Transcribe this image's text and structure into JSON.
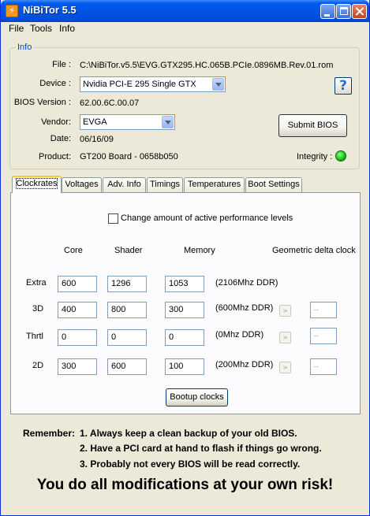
{
  "window": {
    "title": "NiBiTor 5.5"
  },
  "menu": {
    "items": [
      "File",
      "Tools",
      "Info"
    ]
  },
  "info": {
    "group_label": "Info",
    "file_label": "File :",
    "file_value": "C:\\NiBiTor.v5.5\\EVG.GTX295.HC.065B.PCIe.0896MB.Rev.01.rom",
    "device_label": "Device :",
    "device_value": "Nvidia PCI-E 295 Single GTX",
    "bios_label": "BIOS Version :",
    "bios_value": "62.00.6C.00.07",
    "vendor_label": "Vendor:",
    "vendor_value": "EVGA",
    "date_label": "Date:",
    "date_value": "06/16/09",
    "product_label": "Product:",
    "product_value": "GT200 Board - 0658b050",
    "submit_label": "Submit BIOS",
    "help_label": "?",
    "integrity_label": "Integrity :",
    "integrity_color": "#10c010"
  },
  "tabs": [
    "Clockrates",
    "Voltages",
    "Adv. Info",
    "Timings",
    "Temperatures",
    "Boot Settings"
  ],
  "clockrates": {
    "checkbox_label": "Change amount of active performance levels",
    "col_core": "Core",
    "col_shader": "Shader",
    "col_memory": "Memory",
    "col_geo": "Geometric delta clock",
    "rows": [
      {
        "label": "Extra",
        "core": "600",
        "shader": "1296",
        "memory": "1053",
        "ddr": "(2106Mhz DDR)",
        "geo_btn": "",
        "geo": ""
      },
      {
        "label": "3D",
        "core": "400",
        "shader": "800",
        "memory": "300",
        "ddr": "(600Mhz DDR)",
        "geo_btn": ">",
        "geo": "--"
      },
      {
        "label": "Thrtl",
        "core": "0",
        "shader": "0",
        "memory": "0",
        "ddr": "(0Mhz DDR)",
        "geo_btn": ">",
        "geo": "--"
      },
      {
        "label": "2D",
        "core": "300",
        "shader": "600",
        "memory": "100",
        "ddr": "(200Mhz DDR)",
        "geo_btn": ">",
        "geo": "--"
      }
    ],
    "bootup_label": "Bootup clocks"
  },
  "footer": {
    "remember_label": "Remember:",
    "lines": [
      "1. Always keep a clean backup of your old BIOS.",
      "2. Have a PCI card at hand to flash if things go wrong.",
      "3. Probably not every BIOS will be read correctly."
    ],
    "warning": "You do all modifications at your own risk!"
  }
}
